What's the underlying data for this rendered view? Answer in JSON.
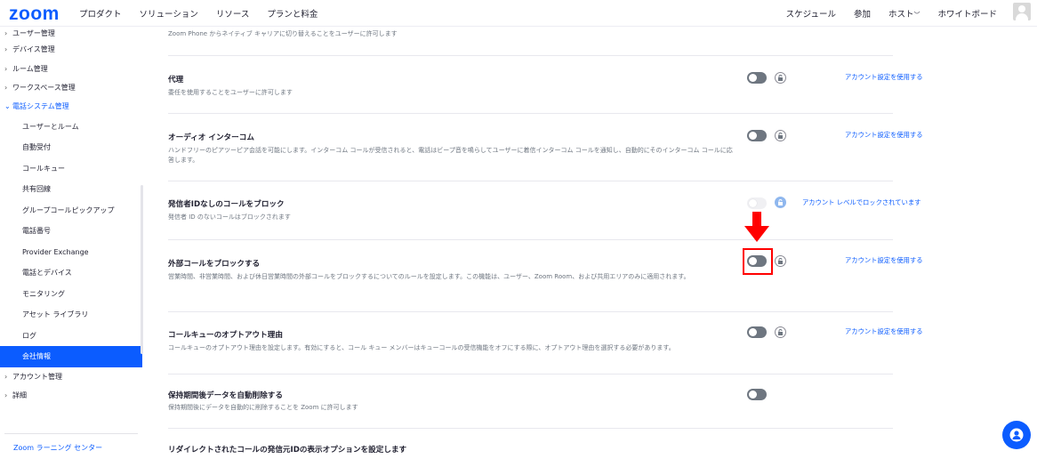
{
  "header": {
    "logo": "zoom",
    "nav_left": [
      "プロダクト",
      "ソリューション",
      "リソース",
      "プランと料金"
    ],
    "nav_right": [
      "スケジュール",
      "参加",
      "ホスト",
      "ホワイトボード"
    ],
    "host_chevron": "﹀"
  },
  "sidebar": {
    "groups_top": [
      {
        "label": "ユーザー管理"
      },
      {
        "label": "デバイス管理"
      },
      {
        "label": "ルーム管理"
      },
      {
        "label": "ワークスペース管理"
      },
      {
        "label": "電話システム管理"
      }
    ],
    "sub_items": [
      {
        "label": "ユーザーとルーム"
      },
      {
        "label": "自動受付"
      },
      {
        "label": "コールキュー"
      },
      {
        "label": "共有回線"
      },
      {
        "label": "グループコールピックアップ"
      },
      {
        "label": "電話番号"
      },
      {
        "label": "Provider Exchange"
      },
      {
        "label": "電話とデバイス"
      },
      {
        "label": "モニタリング"
      },
      {
        "label": "アセット ライブラリ"
      },
      {
        "label": "ログ"
      },
      {
        "label": "会社情報"
      }
    ],
    "groups_bottom": [
      {
        "label": "アカウント管理"
      },
      {
        "label": "詳細"
      }
    ],
    "learning_center": "Zoom ラーニング センター"
  },
  "top_partial_desc": "Zoom Phone からネイティブ キャリアに切り替えることをユーザーに許可します",
  "settings": [
    {
      "title": "代理",
      "desc": "委任を使用することをユーザーに許可します",
      "toggle_on": false,
      "locked": false,
      "link": "アカウント設定を使用する"
    },
    {
      "title": "オーディオ インターコム",
      "desc": "ハンドフリーのピアツーピア会話を可能にします。インターコム コールが受信されると、電話はビープ音を鳴らしてユーザーに着信インターコム コールを通知し、自動的にそのインターコム コールに応答します。",
      "toggle_on": false,
      "locked": false,
      "link": "アカウント設定を使用する"
    },
    {
      "title": "発信者IDなしのコールをブロック",
      "desc": "発信者 ID のないコールはブロックされます",
      "toggle_on": false,
      "locked": true,
      "link": "アカウント レベルでロックされています"
    },
    {
      "title": "外部コールをブロックする",
      "desc": "営業時間、非営業時間、および休日営業時間の外部コールをブロックするについてのルールを設定します。この機能は、ユーザー、Zoom Room、および共用エリアのみに適用されます。",
      "toggle_on": false,
      "locked": false,
      "link": "アカウント設定を使用する"
    },
    {
      "title": "コールキューのオプトアウト理由",
      "desc": "コールキューのオプトアウト理由を設定します。有効にすると、コール キュー メンバーはキューコールの受信機能をオフにする際に、オプトアウト理由を選択する必要があります。",
      "toggle_on": false,
      "locked": false,
      "link": "アカウント設定を使用する"
    },
    {
      "title": "保持期間後データを自動削除する",
      "desc": "保持期間後にデータを自動的に削除することを Zoom に許可します",
      "toggle_on": false
    },
    {
      "title": "リダイレクトされたコールの発信元IDの表示オプションを設定します"
    }
  ],
  "colors": {
    "brand": "#0b5cff",
    "highlight": "#ff0000"
  }
}
